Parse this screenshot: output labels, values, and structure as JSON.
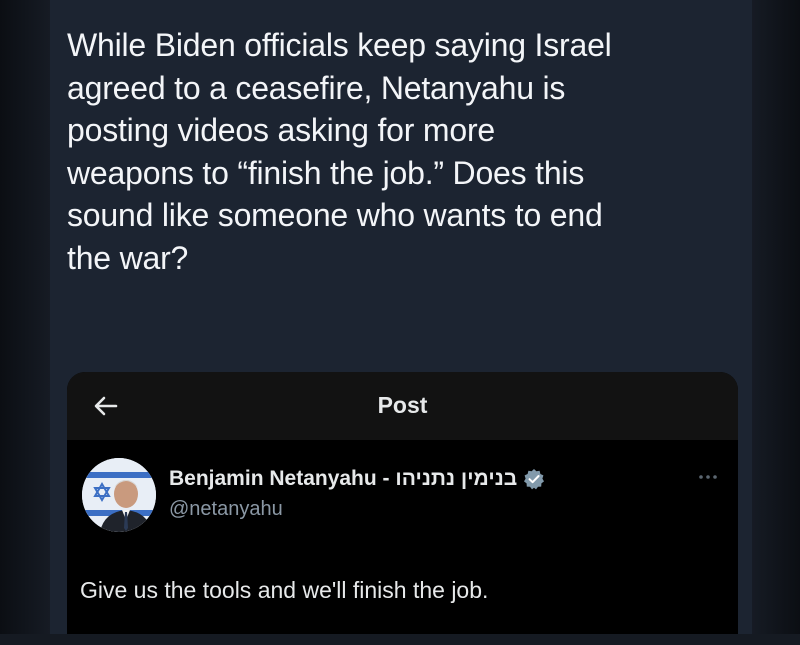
{
  "tweet": {
    "text": "While Biden officials keep saying Israel\nagreed to a ceasefire, Netanyahu is\nposting videos asking for more\nweapons to “finish the job.” Does this\nsound like someone who wants to end\nthe war?"
  },
  "embed": {
    "header": {
      "back_icon": "arrow-left-icon",
      "title": "Post"
    },
    "author": {
      "name": "Benjamin Netanyahu - בנימין נתניהו",
      "handle": "@netanyahu",
      "verified_icon": "verified-badge-icon",
      "more_icon": "more-options-icon"
    },
    "post_text": "Give us the tools and we'll finish the job."
  },
  "colors": {
    "background": "#1c2431",
    "embed_background": "#000000",
    "text_primary": "#e7e9ea",
    "text_secondary": "#8b98a5"
  }
}
